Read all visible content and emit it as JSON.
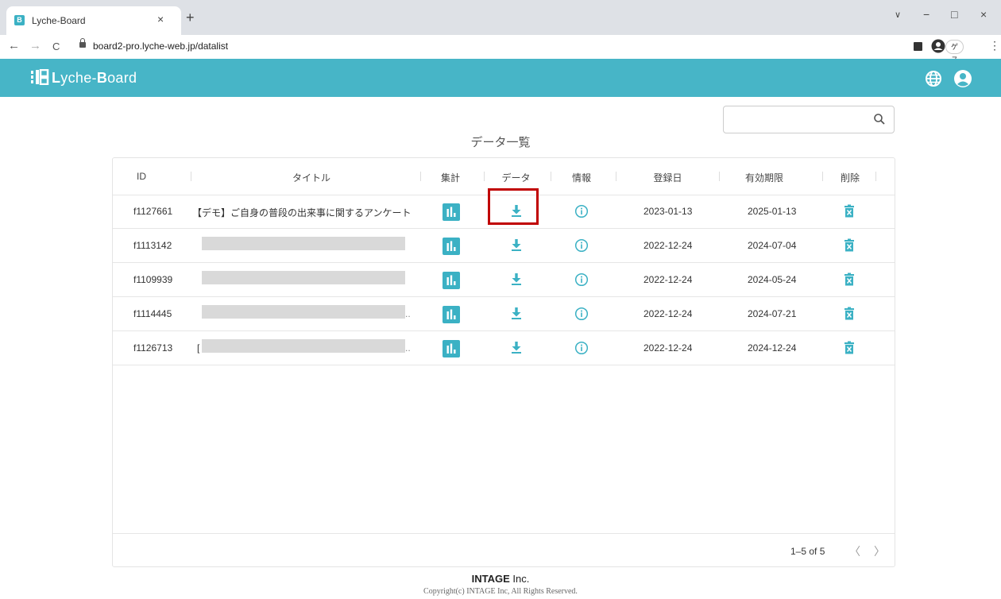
{
  "browser": {
    "tab_title": "Lyche-Board",
    "tab_close": "×",
    "new_tab": "+",
    "url": "board2-pro.lyche-web.jp/datalist",
    "back": "←",
    "forward": "→",
    "reload": "C",
    "guest_label": "ゲスト",
    "menu": "⋮",
    "window_chevron": "∨",
    "window_minimize": "−",
    "window_maximize": "□",
    "window_close": "×"
  },
  "app": {
    "logo_prefix": "L",
    "logo_mid": "yche-",
    "logo_bold": "B",
    "logo_suffix": "oard",
    "accent_color": "#47b5c7"
  },
  "page": {
    "title": "データ一覧",
    "search_placeholder": ""
  },
  "table": {
    "headers": {
      "id": "ID",
      "title": "タイトル",
      "aggregate": "集計",
      "data": "データ",
      "info": "情報",
      "registered": "登録日",
      "expiry": "有効期限",
      "delete": "削除"
    },
    "rows": [
      {
        "id": "f1127661",
        "title": "【デモ】ご自身の普段の出来事に関するアンケート",
        "registered": "2023-01-13",
        "expiry": "2025-01-13",
        "title_suffix": ""
      },
      {
        "id": "f1113142",
        "title": "",
        "registered": "2022-12-24",
        "expiry": "2024-07-04",
        "title_suffix": ""
      },
      {
        "id": "f1109939",
        "title": "",
        "registered": "2022-12-24",
        "expiry": "2024-05-24",
        "title_suffix": ""
      },
      {
        "id": "f1114445",
        "title": "",
        "registered": "2022-12-24",
        "expiry": "2024-07-21",
        "title_suffix": ".."
      },
      {
        "id": "f1126713",
        "title": "[",
        "registered": "2022-12-24",
        "expiry": "2024-12-24",
        "title_suffix": ".."
      }
    ],
    "pagination": {
      "range": "1–5 of 5",
      "prev": "〈",
      "next": "〉"
    }
  },
  "footer": {
    "company_bold": "INTAGE",
    "company_suffix": " Inc.",
    "copyright": "Copyright(c) INTAGE Inc, All Rights Reserved."
  },
  "icons": {
    "download": "download-icon",
    "info": "info-icon",
    "trash": "trash-icon",
    "chart": "bar-chart-icon",
    "search": "search-icon",
    "globe": "globe-icon",
    "account": "account-icon"
  }
}
